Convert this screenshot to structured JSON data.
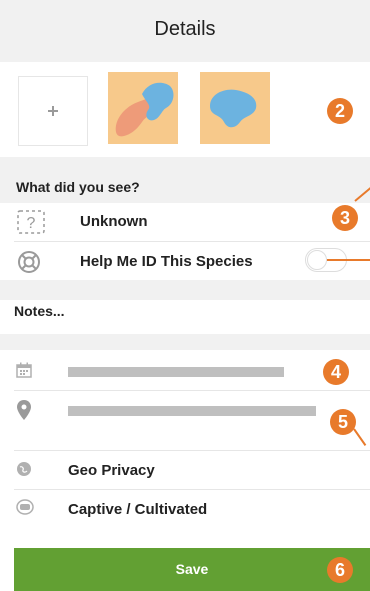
{
  "header": {
    "title": "Details"
  },
  "photos": {
    "add_icon": "plus-icon"
  },
  "badges": [
    "2",
    "3",
    "4",
    "5",
    "6"
  ],
  "observation": {
    "question": "What did you see?",
    "species": "Unknown",
    "help_id_label": "Help Me ID This Species",
    "help_id_enabled": false
  },
  "notes": {
    "placeholder": "Notes..."
  },
  "rows": {
    "geo_privacy": "Geo Privacy",
    "captive": "Captive / Cultivated"
  },
  "save": {
    "label": "Save"
  },
  "colors": {
    "accent": "#e87a2b",
    "save": "#62a033",
    "thumb": "#f7c98b"
  }
}
